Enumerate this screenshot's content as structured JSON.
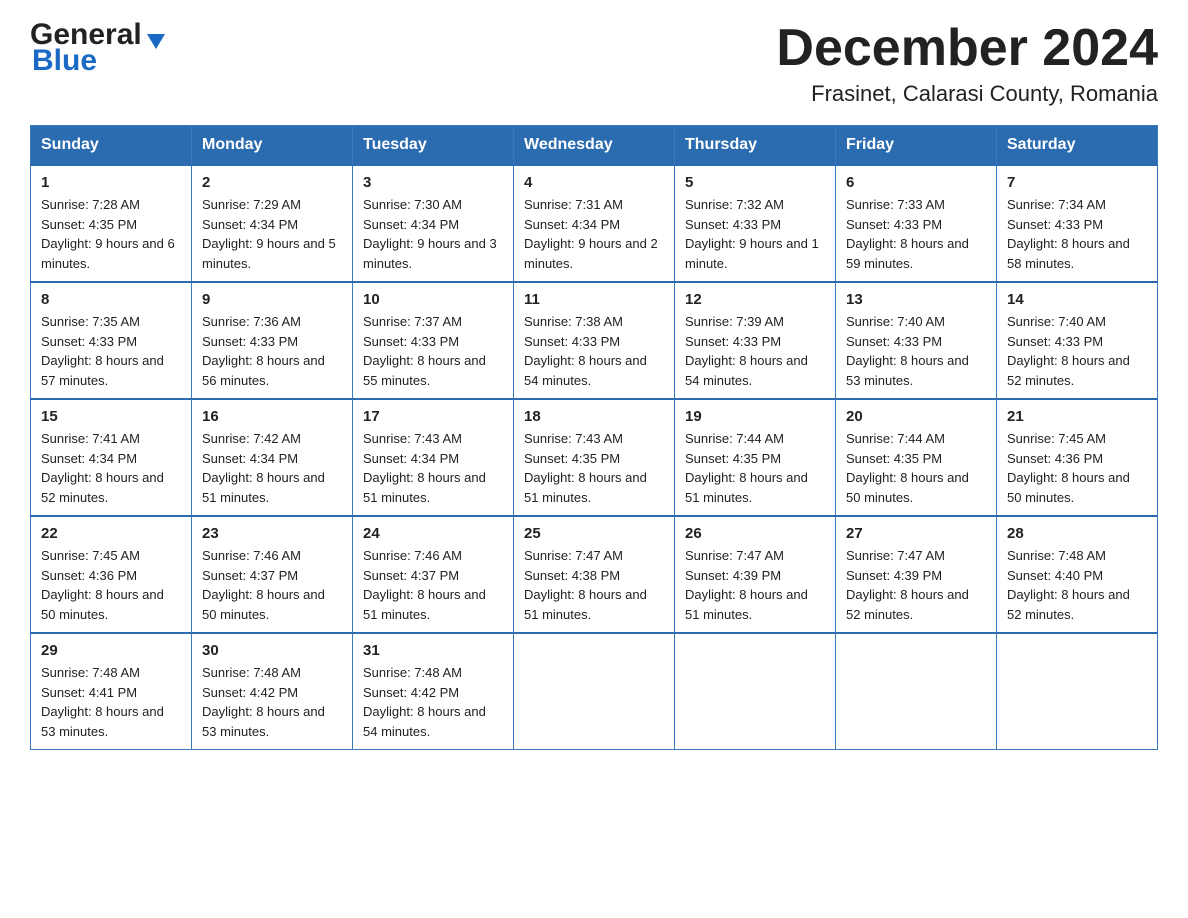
{
  "logo": {
    "general": "General",
    "blue": "Blue",
    "triangle": "▼"
  },
  "title": "December 2024",
  "subtitle": "Frasinet, Calarasi County, Romania",
  "calendar": {
    "headers": [
      "Sunday",
      "Monday",
      "Tuesday",
      "Wednesday",
      "Thursday",
      "Friday",
      "Saturday"
    ],
    "weeks": [
      [
        {
          "day": "1",
          "sunrise": "7:28 AM",
          "sunset": "4:35 PM",
          "daylight": "9 hours and 6 minutes."
        },
        {
          "day": "2",
          "sunrise": "7:29 AM",
          "sunset": "4:34 PM",
          "daylight": "9 hours and 5 minutes."
        },
        {
          "day": "3",
          "sunrise": "7:30 AM",
          "sunset": "4:34 PM",
          "daylight": "9 hours and 3 minutes."
        },
        {
          "day": "4",
          "sunrise": "7:31 AM",
          "sunset": "4:34 PM",
          "daylight": "9 hours and 2 minutes."
        },
        {
          "day": "5",
          "sunrise": "7:32 AM",
          "sunset": "4:33 PM",
          "daylight": "9 hours and 1 minute."
        },
        {
          "day": "6",
          "sunrise": "7:33 AM",
          "sunset": "4:33 PM",
          "daylight": "8 hours and 59 minutes."
        },
        {
          "day": "7",
          "sunrise": "7:34 AM",
          "sunset": "4:33 PM",
          "daylight": "8 hours and 58 minutes."
        }
      ],
      [
        {
          "day": "8",
          "sunrise": "7:35 AM",
          "sunset": "4:33 PM",
          "daylight": "8 hours and 57 minutes."
        },
        {
          "day": "9",
          "sunrise": "7:36 AM",
          "sunset": "4:33 PM",
          "daylight": "8 hours and 56 minutes."
        },
        {
          "day": "10",
          "sunrise": "7:37 AM",
          "sunset": "4:33 PM",
          "daylight": "8 hours and 55 minutes."
        },
        {
          "day": "11",
          "sunrise": "7:38 AM",
          "sunset": "4:33 PM",
          "daylight": "8 hours and 54 minutes."
        },
        {
          "day": "12",
          "sunrise": "7:39 AM",
          "sunset": "4:33 PM",
          "daylight": "8 hours and 54 minutes."
        },
        {
          "day": "13",
          "sunrise": "7:40 AM",
          "sunset": "4:33 PM",
          "daylight": "8 hours and 53 minutes."
        },
        {
          "day": "14",
          "sunrise": "7:40 AM",
          "sunset": "4:33 PM",
          "daylight": "8 hours and 52 minutes."
        }
      ],
      [
        {
          "day": "15",
          "sunrise": "7:41 AM",
          "sunset": "4:34 PM",
          "daylight": "8 hours and 52 minutes."
        },
        {
          "day": "16",
          "sunrise": "7:42 AM",
          "sunset": "4:34 PM",
          "daylight": "8 hours and 51 minutes."
        },
        {
          "day": "17",
          "sunrise": "7:43 AM",
          "sunset": "4:34 PM",
          "daylight": "8 hours and 51 minutes."
        },
        {
          "day": "18",
          "sunrise": "7:43 AM",
          "sunset": "4:35 PM",
          "daylight": "8 hours and 51 minutes."
        },
        {
          "day": "19",
          "sunrise": "7:44 AM",
          "sunset": "4:35 PM",
          "daylight": "8 hours and 51 minutes."
        },
        {
          "day": "20",
          "sunrise": "7:44 AM",
          "sunset": "4:35 PM",
          "daylight": "8 hours and 50 minutes."
        },
        {
          "day": "21",
          "sunrise": "7:45 AM",
          "sunset": "4:36 PM",
          "daylight": "8 hours and 50 minutes."
        }
      ],
      [
        {
          "day": "22",
          "sunrise": "7:45 AM",
          "sunset": "4:36 PM",
          "daylight": "8 hours and 50 minutes."
        },
        {
          "day": "23",
          "sunrise": "7:46 AM",
          "sunset": "4:37 PM",
          "daylight": "8 hours and 50 minutes."
        },
        {
          "day": "24",
          "sunrise": "7:46 AM",
          "sunset": "4:37 PM",
          "daylight": "8 hours and 51 minutes."
        },
        {
          "day": "25",
          "sunrise": "7:47 AM",
          "sunset": "4:38 PM",
          "daylight": "8 hours and 51 minutes."
        },
        {
          "day": "26",
          "sunrise": "7:47 AM",
          "sunset": "4:39 PM",
          "daylight": "8 hours and 51 minutes."
        },
        {
          "day": "27",
          "sunrise": "7:47 AM",
          "sunset": "4:39 PM",
          "daylight": "8 hours and 52 minutes."
        },
        {
          "day": "28",
          "sunrise": "7:48 AM",
          "sunset": "4:40 PM",
          "daylight": "8 hours and 52 minutes."
        }
      ],
      [
        {
          "day": "29",
          "sunrise": "7:48 AM",
          "sunset": "4:41 PM",
          "daylight": "8 hours and 53 minutes."
        },
        {
          "day": "30",
          "sunrise": "7:48 AM",
          "sunset": "4:42 PM",
          "daylight": "8 hours and 53 minutes."
        },
        {
          "day": "31",
          "sunrise": "7:48 AM",
          "sunset": "4:42 PM",
          "daylight": "8 hours and 54 minutes."
        },
        null,
        null,
        null,
        null
      ]
    ]
  }
}
